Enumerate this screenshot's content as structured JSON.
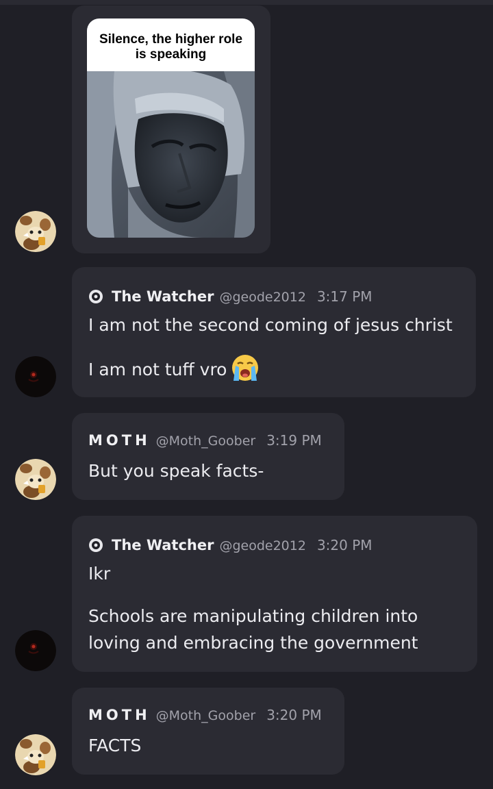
{
  "meme": {
    "caption_line1": "Silence, the higher role",
    "caption_line2": "is speaking"
  },
  "messages": [
    {
      "author": "The Watcher",
      "handle": "@geode2012",
      "time": "3:17 PM",
      "lines": [
        "I am not the second coming of jesus christ",
        "I am not tuff vro"
      ],
      "emoji": "loudly-crying-face"
    },
    {
      "author": "MOTH",
      "handle": "@Moth_Goober",
      "time": "3:19 PM",
      "lines": [
        "But you speak facts-"
      ]
    },
    {
      "author": "The Watcher",
      "handle": "@geode2012",
      "time": "3:20 PM",
      "lines": [
        "Ikr",
        "Schools are manipulating children into",
        "loving and embracing the government"
      ]
    },
    {
      "author": "MOTH",
      "handle": "@Moth_Goober",
      "time": "3:20 PM",
      "lines": [
        "FACTS"
      ]
    }
  ],
  "colors": {
    "background": "#1f1f26",
    "bubble": "#2b2b33",
    "muted_text": "#a2a2ab"
  }
}
